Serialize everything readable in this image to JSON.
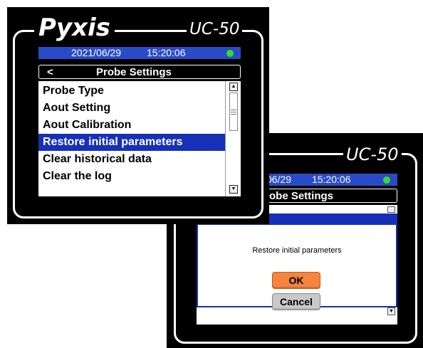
{
  "device1": {
    "brand": "Pyxis",
    "model": "UC-50",
    "status": {
      "date": "2021/06/29",
      "time": "15:20:06",
      "indicator": "green-dot"
    },
    "header": {
      "back_label": "<",
      "title": "Probe Settings"
    },
    "menu": {
      "items": [
        {
          "label": "Probe Type",
          "selected": false
        },
        {
          "label": "Aout Setting",
          "selected": false
        },
        {
          "label": "Aout Calibration",
          "selected": false
        },
        {
          "label": "Restore initial parameters",
          "selected": true
        },
        {
          "label": "Clear historical data",
          "selected": false
        },
        {
          "label": "Clear the log",
          "selected": false
        }
      ]
    }
  },
  "device2": {
    "model": "UC-50",
    "status": {
      "date_partial": "06/29",
      "time": "15:20:06"
    },
    "header": {
      "title_partial": "obe Settings"
    },
    "dialog": {
      "message": "Restore initial parameters",
      "ok_label": "OK",
      "cancel_label": "Cancel"
    }
  },
  "colors": {
    "status_bar": "#2a4bc8",
    "selection": "#1630b8",
    "ok_button": "#f4843e",
    "cancel_button": "#c9c9c9",
    "status_dot": "#2fe02f"
  }
}
